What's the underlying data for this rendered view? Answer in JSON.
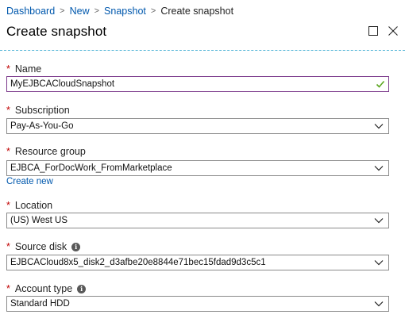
{
  "breadcrumb": {
    "items": [
      "Dashboard",
      "New",
      "Snapshot"
    ],
    "current": "Create snapshot"
  },
  "title": "Create snapshot",
  "fields": {
    "name": {
      "label": "Name",
      "value": "MyEJBCACloudSnapshot"
    },
    "subscription": {
      "label": "Subscription",
      "value": "Pay-As-You-Go"
    },
    "resource_group": {
      "label": "Resource group",
      "value": "EJBCA_ForDocWork_FromMarketplace",
      "link": "Create new"
    },
    "location": {
      "label": "Location",
      "value": "(US) West US"
    },
    "source_disk": {
      "label": "Source disk",
      "value": "EJBCACloud8x5_disk2_d3afbe20e8844e71bec15fdad9d3c5c1"
    },
    "account_type": {
      "label": "Account type",
      "value": "Standard HDD"
    }
  },
  "colors": {
    "link": "#0058ad",
    "required": "#c00000",
    "valid_check": "#5ba61e",
    "name_border": "#7c3a8c"
  }
}
